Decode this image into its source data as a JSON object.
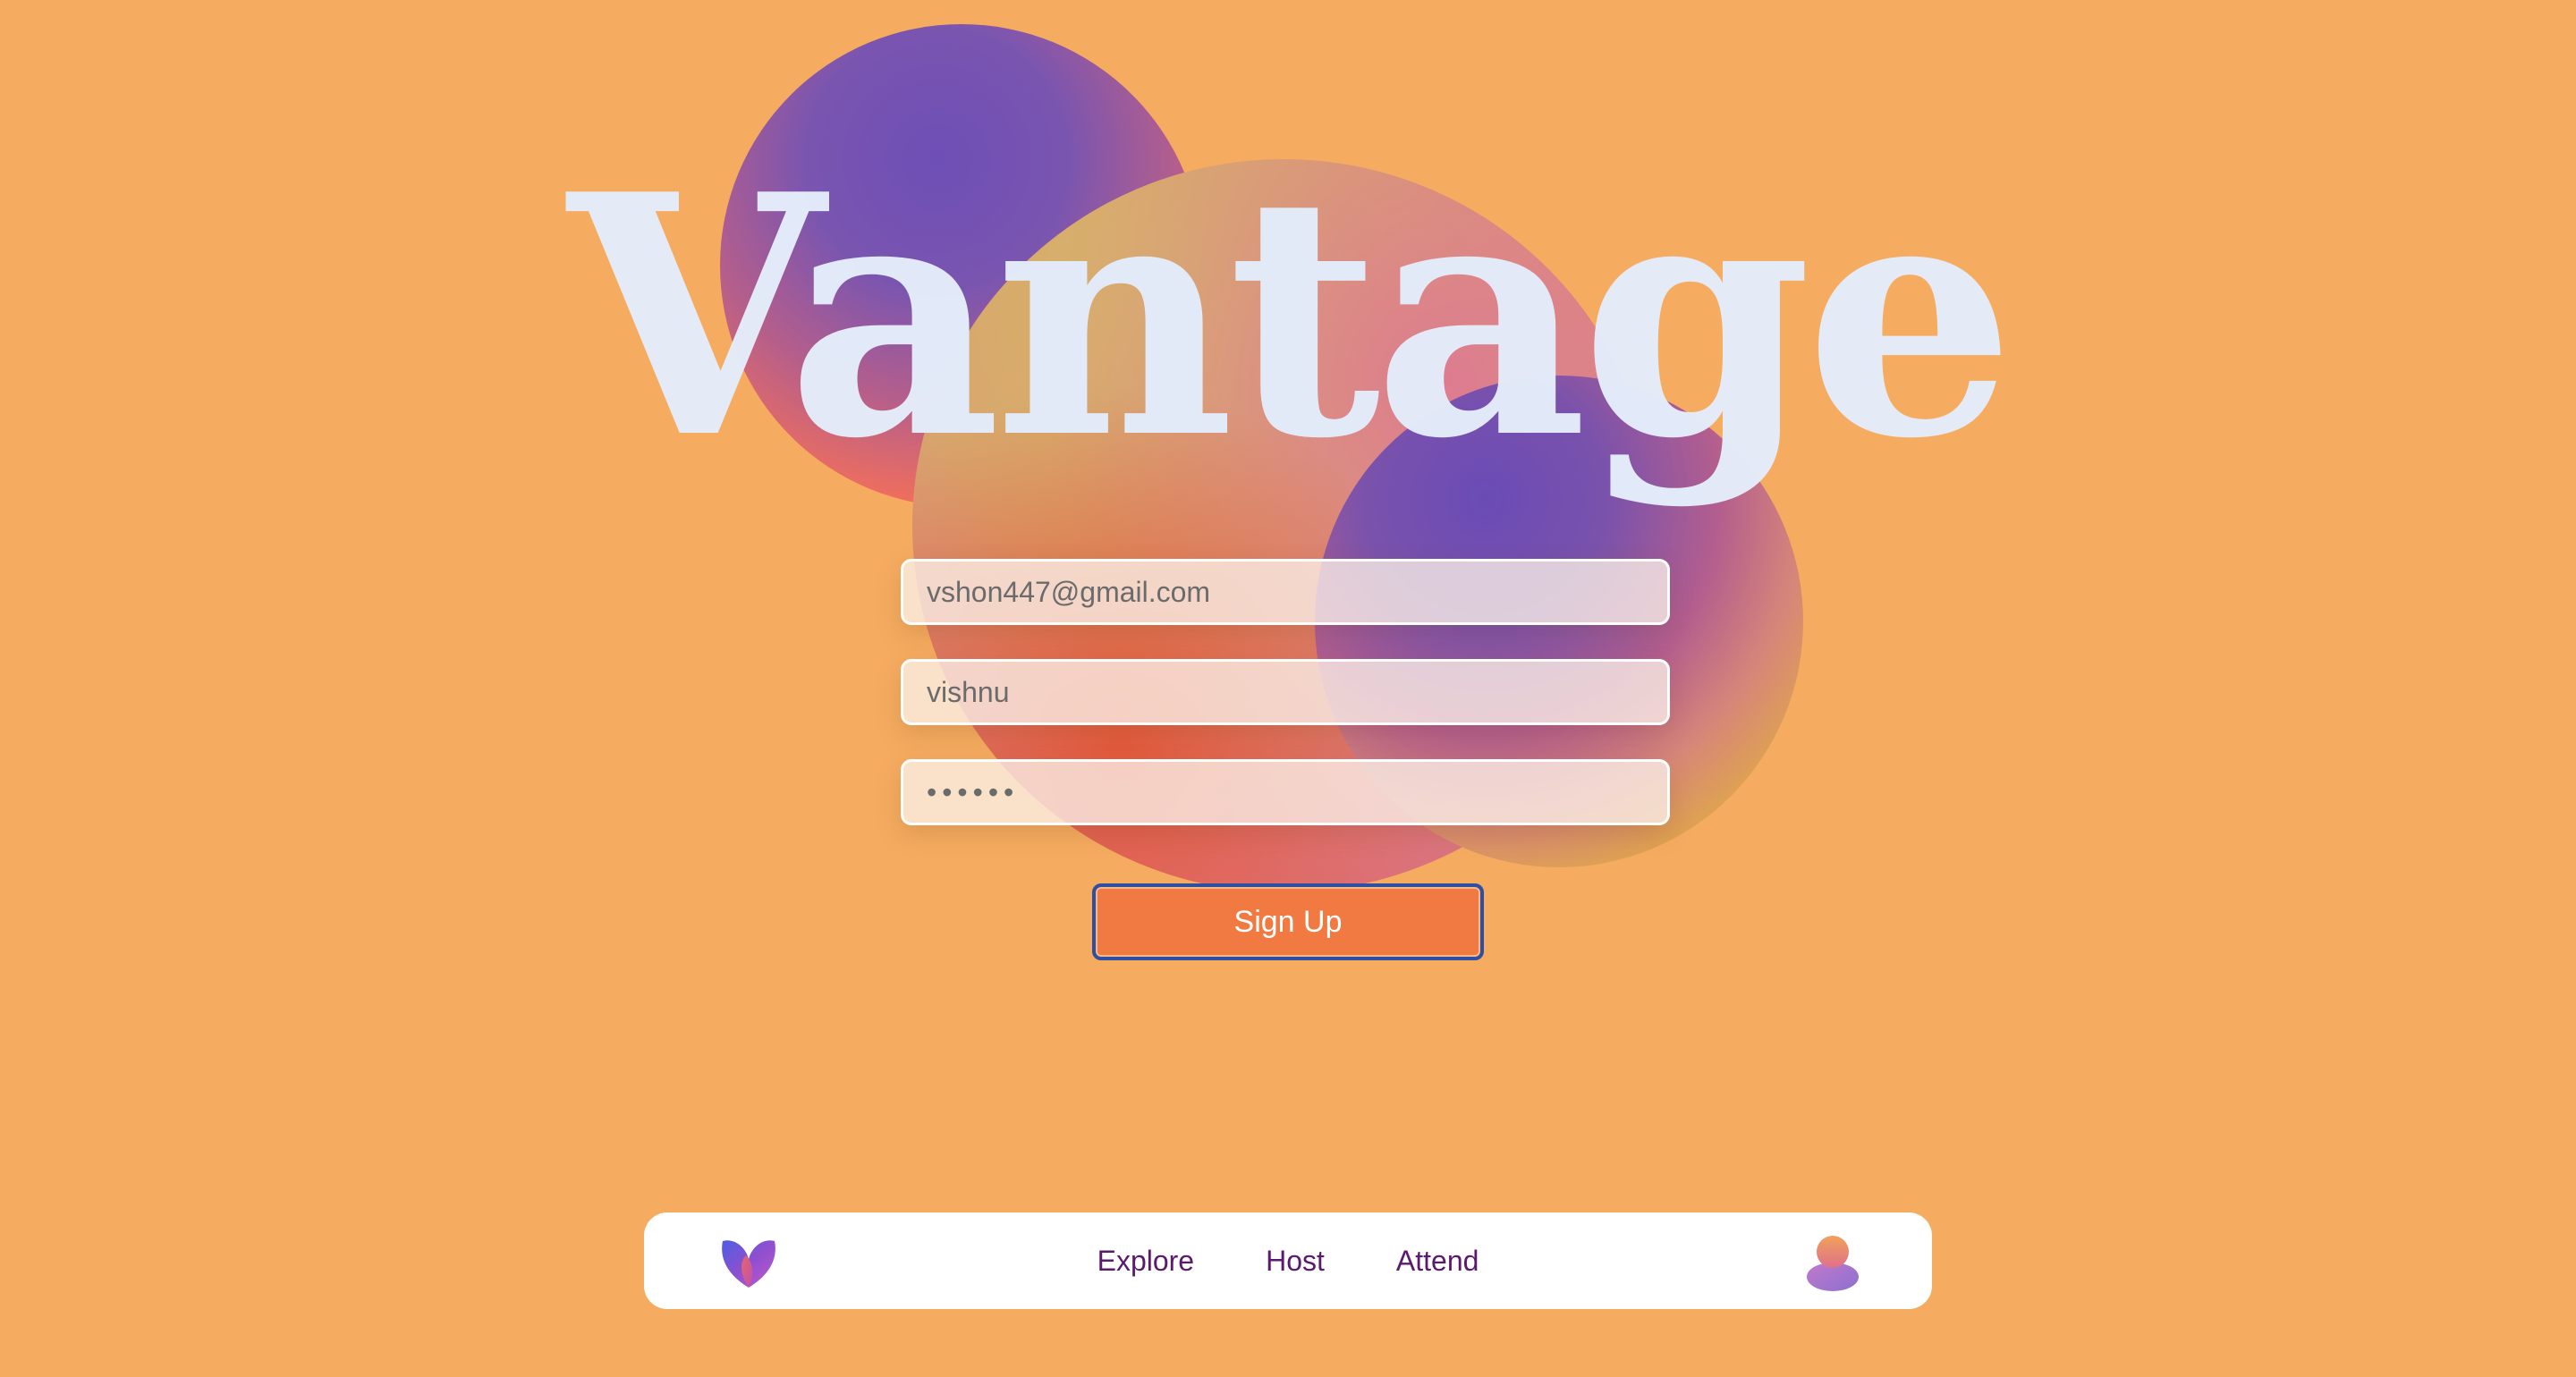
{
  "app": {
    "title": "Vantage"
  },
  "form": {
    "email_value": "vshon447@gmail.com",
    "username_value": "vishnu",
    "password_value": "••••••",
    "signup_label": "Sign Up"
  },
  "nav": {
    "logo_icon": "heart-logo-icon",
    "links": [
      {
        "label": "Explore"
      },
      {
        "label": "Host"
      },
      {
        "label": "Attend"
      }
    ],
    "avatar_icon": "user-avatar-icon"
  },
  "colors": {
    "background": "#F5AC60",
    "title": "#E4ECFA",
    "button": "#F07A42",
    "button_border": "#2F4FA0",
    "nav_text": "#5B1A6E"
  }
}
